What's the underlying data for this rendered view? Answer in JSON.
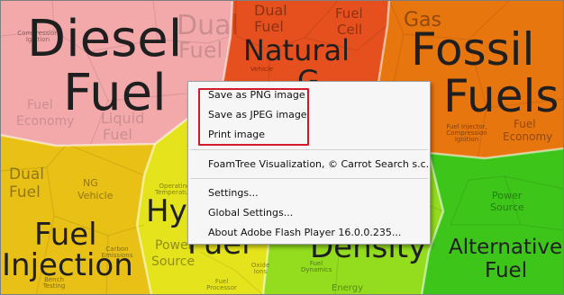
{
  "treemap": {
    "cells": {
      "diesel_fuel": "Diesel Fuel",
      "natural_gas": "Natural Gas",
      "fossil_fuels": "Fossil Fuels",
      "fuel_injection": "Fuel Injection",
      "alternative_fuel": "Alternative Fuel",
      "hydrogen_fuel": "Hy... Fuel",
      "energy_density": "...Density"
    },
    "labels": {
      "diesel_fuel_l1": "Diesel",
      "diesel_fuel_l2": "Fuel",
      "natural_gas_l1": "Natural",
      "natural_gas_l2": "G",
      "fossil_l1": "Fossil",
      "fossil_l2": "Fuels",
      "fuel_injection_l1": "Fuel",
      "fuel_injection_l2": "Injection",
      "alternative_l1": "Alternative",
      "alternative_l2": "Fuel",
      "hydrogen_l1": "Hy",
      "hydrogen_l2": "Fuel",
      "density": "Density",
      "dual_fuel_a1": "Dual",
      "dual_fuel_a2": "Fuel",
      "dual_fuel_b1": "Dual",
      "dual_fuel_b2": "Fuel",
      "fuel_cell_1": "Fuel",
      "fuel_cell_2": "Cell",
      "gas_1": "Gas",
      "dual_fuel_c1": "Dual",
      "dual_fuel_c2": "Fuel",
      "ng_vehicle_1": "NG",
      "ng_vehicle_2": "Vehicle",
      "liquid_fuel_1": "Liquid",
      "liquid_fuel_2": "Fuel",
      "fuel_economy_a1": "Fuel",
      "fuel_economy_a2": "Economy",
      "fuel_economy_b1": "Fuel",
      "fuel_economy_b2": "Economy",
      "power_source_1": "Power",
      "power_source_2": "Source",
      "compression_ignition_1": "Compression",
      "compression_ignition_2": "Ignition",
      "fuel_injector_1": "Fuel Injector,",
      "fuel_injector_2": "Compression",
      "fuel_injector_3": "Ignition",
      "vehicle": "Vehicle",
      "carbon_emissions_1": "Carbon",
      "carbon_emissions_2": "Emissions",
      "oxide_ions_1": "Oxide",
      "oxide_ions_2": "Ions",
      "operating_temperature_1": "Operating",
      "operating_temperature_2": "Temperature",
      "bench_testing_1": "Bench",
      "bench_testing_2": "Testing",
      "fuel_processor_1": "Fuel",
      "fuel_processor_2": "Processor",
      "energy": "Energy",
      "power_source_b1": "Power",
      "power_source_b2": "Source",
      "fuel_dynamics_1": "Fuel",
      "fuel_dynamics_2": "Dynamics"
    },
    "colors": {
      "diesel": "#f3a9aa",
      "natural_gas": "#e5501e",
      "fossil": "#e8760f",
      "fuel_injection": "#e9c015",
      "hydrogen": "#e5e41c",
      "density": "#93dc1e",
      "alternative": "#3ec51a"
    }
  },
  "context_menu": {
    "items": [
      {
        "label": "Save as PNG image"
      },
      {
        "label": "Save as JPEG image"
      },
      {
        "label": "Print image"
      },
      {
        "label": "FoamTree Visualization, © Carrot Search s.c."
      },
      {
        "label": "Settings..."
      },
      {
        "label": "Global Settings..."
      },
      {
        "label": "About Adobe Flash Player 16.0.0.235..."
      }
    ],
    "highlight_color": "#d31a2b"
  }
}
